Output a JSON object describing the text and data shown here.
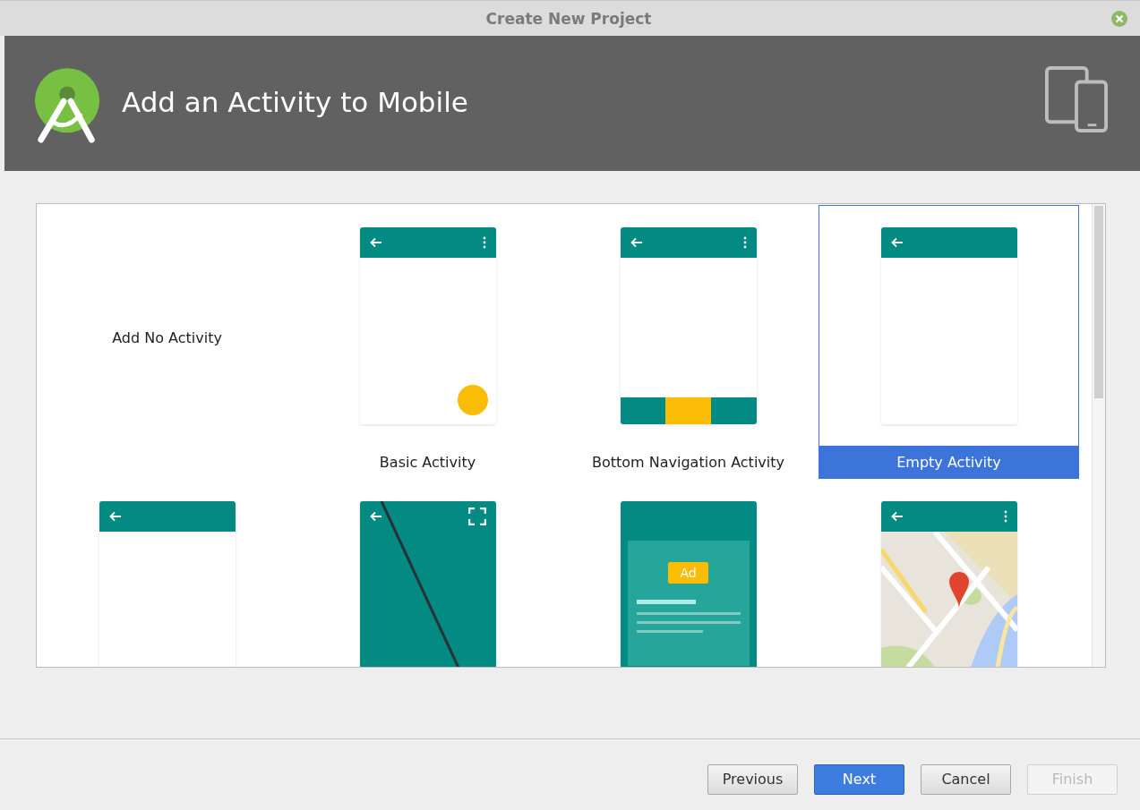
{
  "window": {
    "title": "Create New Project"
  },
  "header": {
    "title": "Add an Activity to Mobile"
  },
  "gallery": [
    {
      "kind": "none",
      "label": "Add No Activity",
      "selected": false
    },
    {
      "kind": "basic",
      "label": "Basic Activity",
      "selected": false
    },
    {
      "kind": "bottom_nav",
      "label": "Bottom Navigation Activity",
      "selected": false
    },
    {
      "kind": "empty",
      "label": "Empty Activity",
      "selected": true
    },
    {
      "kind": "empty",
      "selected": false
    },
    {
      "kind": "fullscreen",
      "selected": false
    },
    {
      "kind": "ad",
      "badge": "Ad",
      "selected": false
    },
    {
      "kind": "map",
      "selected": false
    }
  ],
  "buttons": [
    {
      "label": "Previous",
      "kind": "normal",
      "disabled": false
    },
    {
      "label": "Next",
      "kind": "default",
      "disabled": false
    },
    {
      "label": "Cancel",
      "kind": "normal",
      "disabled": false
    },
    {
      "label": "Finish",
      "kind": "normal",
      "disabled": true
    }
  ]
}
